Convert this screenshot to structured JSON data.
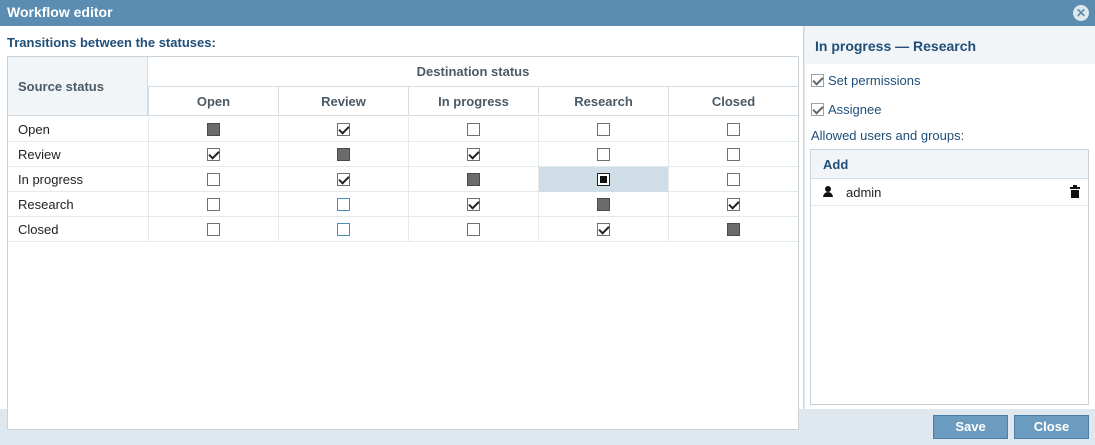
{
  "window": {
    "title": "Workflow editor",
    "close_glyph": "✕"
  },
  "matrix": {
    "heading": "Transitions between the statuses:",
    "source_header": "Source status",
    "destination_header": "Destination status",
    "columns": [
      "Open",
      "Review",
      "In progress",
      "Research",
      "Closed"
    ],
    "rows": [
      {
        "label": "Open",
        "cells": [
          "blocked",
          "checked",
          "unchecked",
          "unchecked",
          "unchecked"
        ]
      },
      {
        "label": "Review",
        "cells": [
          "checked",
          "blocked",
          "checked",
          "unchecked",
          "unchecked"
        ]
      },
      {
        "label": "In progress",
        "cells": [
          "unchecked",
          "checked",
          "blocked",
          "selected",
          "unchecked"
        ]
      },
      {
        "label": "Research",
        "cells": [
          "unchecked",
          "unchecked-blue",
          "checked",
          "blocked",
          "checked"
        ]
      },
      {
        "label": "Closed",
        "cells": [
          "unchecked",
          "unchecked-blue",
          "unchecked",
          "checked",
          "blocked"
        ]
      }
    ]
  },
  "panel": {
    "title": "In progress — Research",
    "set_permissions": {
      "label": "Set permissions",
      "checked": true
    },
    "assignee": {
      "label": "Assignee",
      "checked": true
    },
    "allowed_label": "Allowed users and groups:",
    "add_label": "Add",
    "users": [
      {
        "name": "admin",
        "icon": "user-icon"
      }
    ]
  },
  "footer": {
    "save_label": "Save",
    "close_label": "Close"
  },
  "colors": {
    "titlebar": "#5a8db1",
    "heading": "#1f4e79",
    "button": "#6b9cc0",
    "selected_cell": "#cfdde6"
  }
}
